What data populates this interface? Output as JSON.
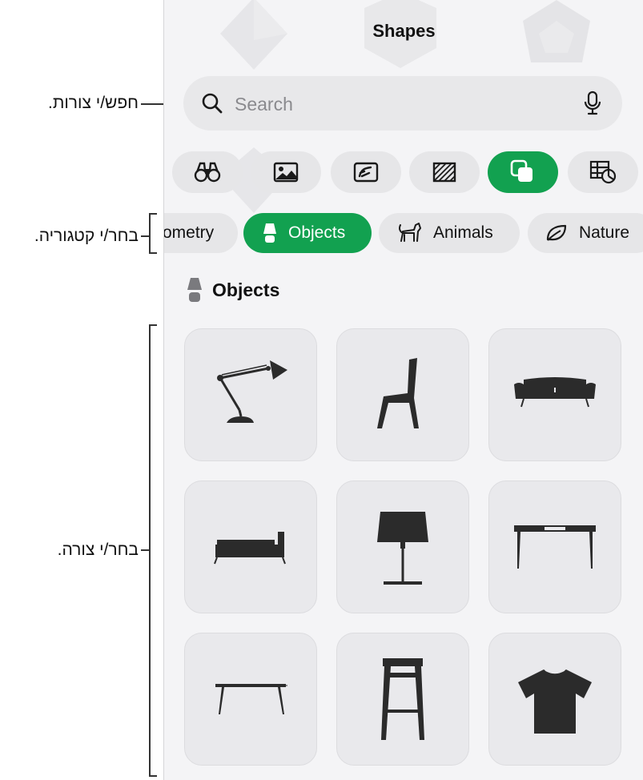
{
  "callouts": {
    "search": "חפש/י צורות.",
    "category": "בחר/י קטגוריה.",
    "shape": "בחר/י צורה."
  },
  "panel": {
    "title": "Shapes",
    "search": {
      "placeholder": "Search"
    },
    "category_icons": [
      "binoculars-icon",
      "image-icon",
      "photo-gallery-icon",
      "texture-icon",
      "shapes-icon",
      "table-chart-icon"
    ],
    "active_category_icon": "shapes-icon",
    "pills": [
      {
        "label": "ometry"
      },
      {
        "label": "Objects",
        "active": true
      },
      {
        "label": "Animals"
      },
      {
        "label": "Nature"
      }
    ],
    "section_title": "Objects",
    "shapes": [
      "desk-lamp",
      "chair",
      "sofa",
      "bed",
      "table-lamp",
      "desk",
      "coffee-table",
      "bar-stool",
      "t-shirt"
    ]
  },
  "colors": {
    "accent": "#12a150",
    "panel_bg": "#f4f4f6",
    "tile_bg": "#e9e9ec",
    "icon": "#2b2b2b"
  }
}
